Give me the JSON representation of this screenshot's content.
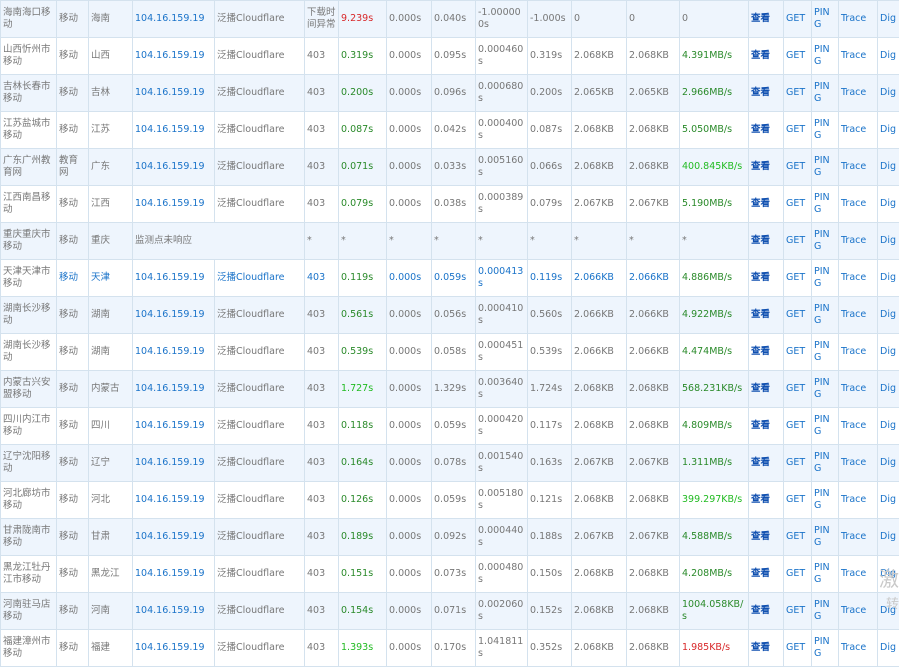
{
  "actions": {
    "view": "查看",
    "get": "GET",
    "ping": "PING",
    "trace": "Trace",
    "dig": "Dig"
  },
  "rows": [
    {
      "node": "海南海口移动",
      "isp": "移动",
      "region": "海南",
      "ip": "104.16.159.19",
      "loc": "泛播Cloudflare",
      "status": "下载时间异常",
      "total": "9.239s",
      "dns": "0.000s",
      "connect": "0.040s",
      "ssl": "-1.000000s",
      "first": "-1.000s",
      "header": "0",
      "size": "0",
      "speed": "0"
    },
    {
      "node": "山西忻州市移动",
      "isp": "移动",
      "region": "山西",
      "ip": "104.16.159.19",
      "loc": "泛播Cloudflare",
      "status": "403",
      "total": "0.319s",
      "dns": "0.000s",
      "connect": "0.095s",
      "ssl": "0.000460s",
      "first": "0.319s",
      "header": "2.068KB",
      "size": "2.068KB",
      "speed": "4.391MB/s"
    },
    {
      "node": "吉林长春市移动",
      "isp": "移动",
      "region": "吉林",
      "ip": "104.16.159.19",
      "loc": "泛播Cloudflare",
      "status": "403",
      "total": "0.200s",
      "dns": "0.000s",
      "connect": "0.096s",
      "ssl": "0.000680s",
      "first": "0.200s",
      "header": "2.065KB",
      "size": "2.065KB",
      "speed": "2.966MB/s"
    },
    {
      "node": "江苏盐城市移动",
      "isp": "移动",
      "region": "江苏",
      "ip": "104.16.159.19",
      "loc": "泛播Cloudflare",
      "status": "403",
      "total": "0.087s",
      "dns": "0.000s",
      "connect": "0.042s",
      "ssl": "0.000400s",
      "first": "0.087s",
      "header": "2.068KB",
      "size": "2.068KB",
      "speed": "5.050MB/s"
    },
    {
      "node": "广东广州教育网",
      "isp": "教育网",
      "region": "广东",
      "ip": "104.16.159.19",
      "loc": "泛播Cloudflare",
      "status": "403",
      "total": "0.071s",
      "dns": "0.000s",
      "connect": "0.033s",
      "ssl": "0.005160s",
      "first": "0.066s",
      "header": "2.068KB",
      "size": "2.068KB",
      "speed": "400.845KB/s"
    },
    {
      "node": "江西南昌移动",
      "isp": "移动",
      "region": "江西",
      "ip": "104.16.159.19",
      "loc": "泛播Cloudflare",
      "status": "403",
      "total": "0.079s",
      "dns": "0.000s",
      "connect": "0.038s",
      "ssl": "0.000389s",
      "first": "0.079s",
      "header": "2.067KB",
      "size": "2.067KB",
      "speed": "5.190MB/s"
    },
    {
      "node": "重庆重庆市移动",
      "isp": "移动",
      "region": "重庆",
      "ip": "监测点未响应",
      "loc": "",
      "status": "*",
      "total": "*",
      "dns": "*",
      "connect": "*",
      "ssl": "*",
      "first": "*",
      "header": "*",
      "size": "*",
      "speed": "*"
    },
    {
      "node": "天津天津市移动",
      "isp": "移动",
      "region": "天津",
      "ip": "104.16.159.19",
      "loc": "泛播Cloudflare",
      "status": "403",
      "total": "0.119s",
      "dns": "0.000s",
      "connect": "0.059s",
      "ssl": "0.000413s",
      "first": "0.119s",
      "header": "2.066KB",
      "size": "2.066KB",
      "speed": "4.886MB/s"
    },
    {
      "node": "湖南长沙移动",
      "isp": "移动",
      "region": "湖南",
      "ip": "104.16.159.19",
      "loc": "泛播Cloudflare",
      "status": "403",
      "total": "0.561s",
      "dns": "0.000s",
      "connect": "0.056s",
      "ssl": "0.000410s",
      "first": "0.560s",
      "header": "2.066KB",
      "size": "2.066KB",
      "speed": "4.922MB/s"
    },
    {
      "node": "湖南长沙移动",
      "isp": "移动",
      "region": "湖南",
      "ip": "104.16.159.19",
      "loc": "泛播Cloudflare",
      "status": "403",
      "total": "0.539s",
      "dns": "0.000s",
      "connect": "0.058s",
      "ssl": "0.000451s",
      "first": "0.539s",
      "header": "2.066KB",
      "size": "2.066KB",
      "speed": "4.474MB/s"
    },
    {
      "node": "内蒙古兴安盟移动",
      "isp": "移动",
      "region": "内蒙古",
      "ip": "104.16.159.19",
      "loc": "泛播Cloudflare",
      "status": "403",
      "total": "1.727s",
      "dns": "0.000s",
      "connect": "1.329s",
      "ssl": "0.003640s",
      "first": "1.724s",
      "header": "2.068KB",
      "size": "2.068KB",
      "speed": "568.231KB/s"
    },
    {
      "node": "四川内江市移动",
      "isp": "移动",
      "region": "四川",
      "ip": "104.16.159.19",
      "loc": "泛播Cloudflare",
      "status": "403",
      "total": "0.118s",
      "dns": "0.000s",
      "connect": "0.059s",
      "ssl": "0.000420s",
      "first": "0.117s",
      "header": "2.068KB",
      "size": "2.068KB",
      "speed": "4.809MB/s"
    },
    {
      "node": "辽宁沈阳移动",
      "isp": "移动",
      "region": "辽宁",
      "ip": "104.16.159.19",
      "loc": "泛播Cloudflare",
      "status": "403",
      "total": "0.164s",
      "dns": "0.000s",
      "connect": "0.078s",
      "ssl": "0.001540s",
      "first": "0.163s",
      "header": "2.067KB",
      "size": "2.067KB",
      "speed": "1.311MB/s"
    },
    {
      "node": "河北廊坊市移动",
      "isp": "移动",
      "region": "河北",
      "ip": "104.16.159.19",
      "loc": "泛播Cloudflare",
      "status": "403",
      "total": "0.126s",
      "dns": "0.000s",
      "connect": "0.059s",
      "ssl": "0.005180s",
      "first": "0.121s",
      "header": "2.068KB",
      "size": "2.068KB",
      "speed": "399.297KB/s"
    },
    {
      "node": "甘肃陇南市移动",
      "isp": "移动",
      "region": "甘肃",
      "ip": "104.16.159.19",
      "loc": "泛播Cloudflare",
      "status": "403",
      "total": "0.189s",
      "dns": "0.000s",
      "connect": "0.092s",
      "ssl": "0.000440s",
      "first": "0.188s",
      "header": "2.067KB",
      "size": "2.067KB",
      "speed": "4.588MB/s"
    },
    {
      "node": "黑龙江牡丹江市移动",
      "isp": "移动",
      "region": "黑龙江",
      "ip": "104.16.159.19",
      "loc": "泛播Cloudflare",
      "status": "403",
      "total": "0.151s",
      "dns": "0.000s",
      "connect": "0.073s",
      "ssl": "0.000480s",
      "first": "0.150s",
      "header": "2.068KB",
      "size": "2.068KB",
      "speed": "4.208MB/s"
    },
    {
      "node": "河南驻马店移动",
      "isp": "移动",
      "region": "河南",
      "ip": "104.16.159.19",
      "loc": "泛播Cloudflare",
      "status": "403",
      "total": "0.154s",
      "dns": "0.000s",
      "connect": "0.071s",
      "ssl": "0.002060s",
      "first": "0.152s",
      "header": "2.068KB",
      "size": "2.068KB",
      "speed": "1004.058KB/s"
    },
    {
      "node": "福建漳州市移动",
      "isp": "移动",
      "region": "福建",
      "ip": "104.16.159.19",
      "loc": "泛播Cloudflare",
      "status": "403",
      "total": "1.393s",
      "dns": "0.000s",
      "connect": "0.170s",
      "ssl": "1.041811s",
      "first": "0.352s",
      "header": "2.068KB",
      "size": "2.068KB",
      "speed": "1.985KB/s"
    }
  ],
  "colors": {
    "total": [
      "red",
      "green",
      "green",
      "green",
      "green",
      "green",
      "",
      "green",
      "green",
      "green",
      "lgreen",
      "green",
      "green",
      "green",
      "green",
      "green",
      "green",
      "lgreen"
    ],
    "speed": [
      "",
      "green",
      "green",
      "green",
      "lgreen",
      "green",
      "",
      "green",
      "green",
      "green",
      "green",
      "green",
      "green",
      "lgreen",
      "green",
      "green",
      "green",
      "red"
    ]
  },
  "watermark": {
    "line1": "激",
    "line2": "转"
  }
}
